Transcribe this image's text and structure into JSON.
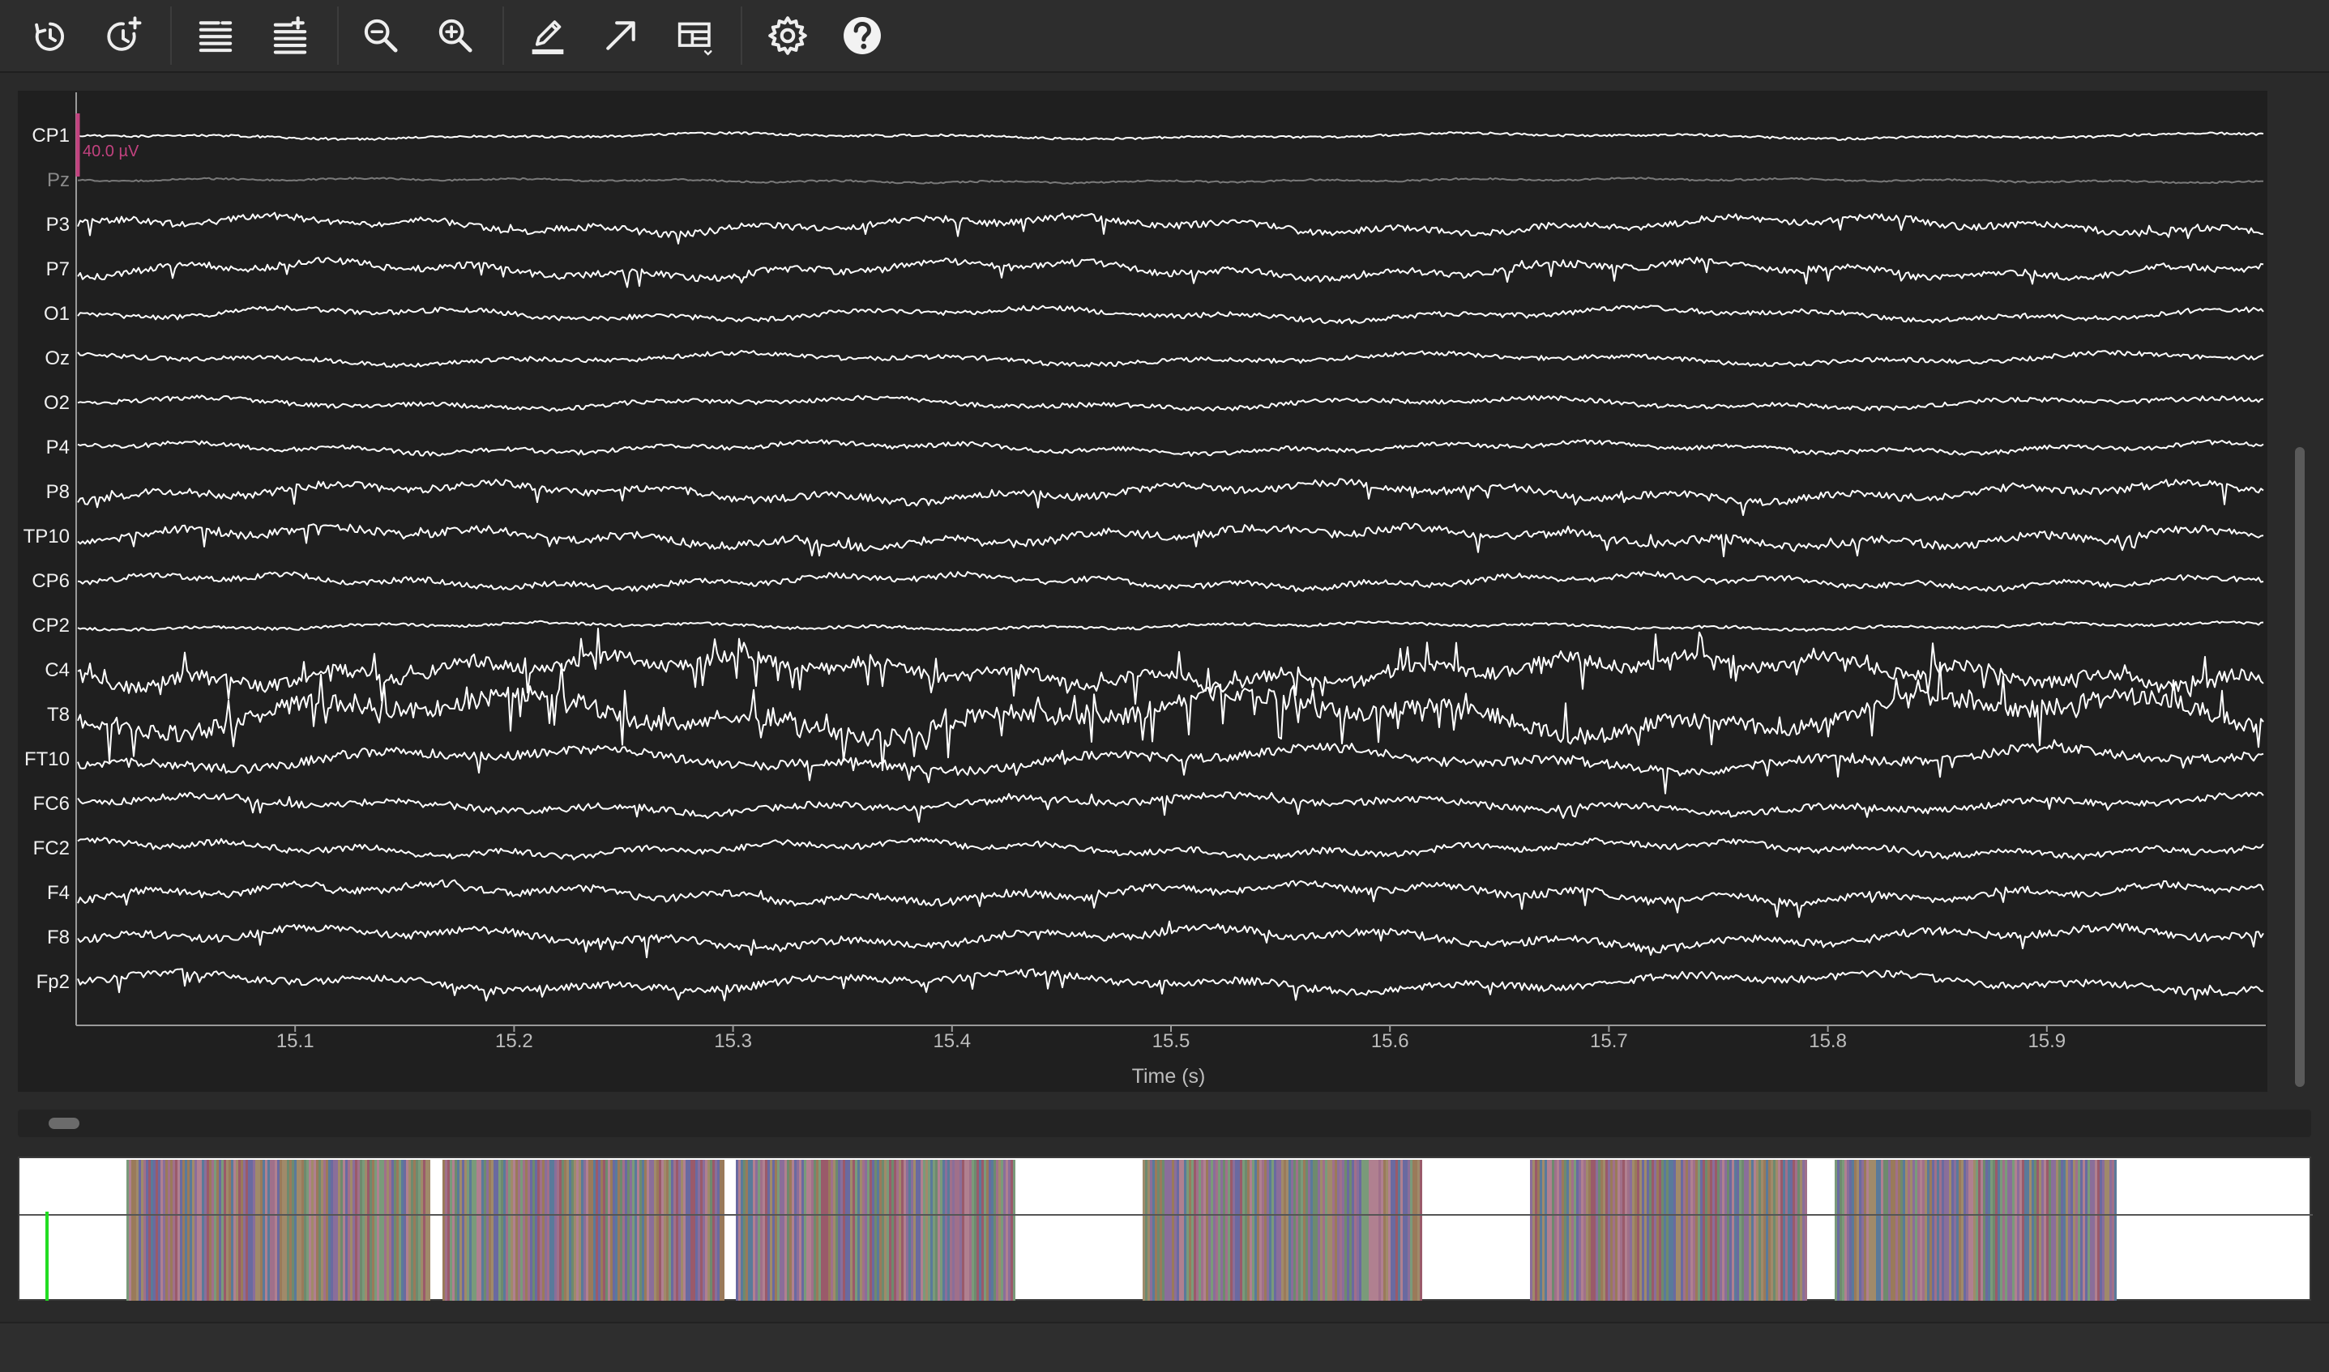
{
  "toolbar": {
    "buttons": [
      {
        "name": "history-back-button",
        "icon": "clock-rewind-icon"
      },
      {
        "name": "history-forward-button",
        "icon": "clock-plus-icon"
      },
      {
        "name": "fewer-channels-button",
        "icon": "lines-minus-icon"
      },
      {
        "name": "more-channels-button",
        "icon": "lines-plus-icon"
      },
      {
        "name": "zoom-out-button",
        "icon": "magnifier-minus-icon"
      },
      {
        "name": "zoom-in-button",
        "icon": "magnifier-plus-icon"
      },
      {
        "name": "annotation-mode-button",
        "icon": "pencil-icon"
      },
      {
        "name": "projectors-button",
        "icon": "arrow-up-right-icon"
      },
      {
        "name": "layout-button",
        "icon": "table-chevron-icon"
      },
      {
        "name": "settings-button",
        "icon": "gear-icon"
      },
      {
        "name": "help-button",
        "icon": "question-circle-icon"
      }
    ]
  },
  "browser": {
    "channels": [
      {
        "name": "CP1",
        "bad": false
      },
      {
        "name": "Pz",
        "bad": true
      },
      {
        "name": "P3",
        "bad": false
      },
      {
        "name": "P7",
        "bad": false
      },
      {
        "name": "O1",
        "bad": false
      },
      {
        "name": "Oz",
        "bad": false
      },
      {
        "name": "O2",
        "bad": false
      },
      {
        "name": "P4",
        "bad": false
      },
      {
        "name": "P8",
        "bad": false
      },
      {
        "name": "TP10",
        "bad": false
      },
      {
        "name": "CP6",
        "bad": false
      },
      {
        "name": "CP2",
        "bad": false
      },
      {
        "name": "C4",
        "bad": false
      },
      {
        "name": "T8",
        "bad": false
      },
      {
        "name": "FT10",
        "bad": false
      },
      {
        "name": "FC6",
        "bad": false
      },
      {
        "name": "FC2",
        "bad": false
      },
      {
        "name": "F4",
        "bad": false
      },
      {
        "name": "F8",
        "bad": false
      },
      {
        "name": "Fp2",
        "bad": false
      }
    ],
    "scale_label": "40.0 µV",
    "x_ticks": [
      "15.1",
      "15.2",
      "15.3",
      "15.4",
      "15.5",
      "15.6",
      "15.7",
      "15.8",
      "15.9"
    ],
    "x_tick_values": [
      15.1,
      15.2,
      15.3,
      15.4,
      15.5,
      15.6,
      15.7,
      15.8,
      15.9
    ],
    "x_range": [
      15.0,
      16.0
    ],
    "xlabel": "Time (s)",
    "colors": {
      "background": "#1f1f1f",
      "trace": "#ffffff",
      "bad_trace": "#7a7a7a",
      "scale_bar": "#c2427f"
    }
  },
  "overview": {
    "colors": {
      "cursor": "#22dd22",
      "background": "#ffffff",
      "midline": "#555555"
    }
  }
}
